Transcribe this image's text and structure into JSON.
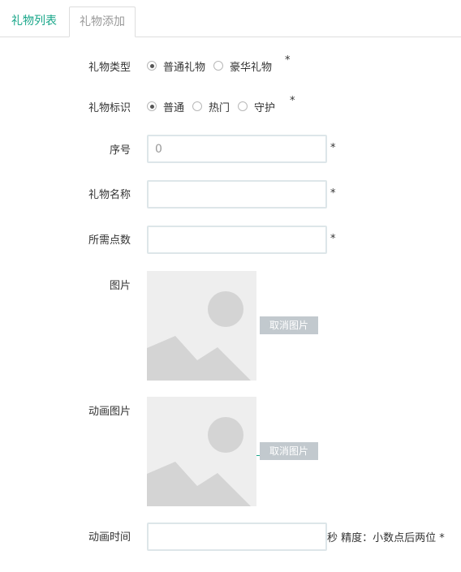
{
  "tabs": [
    {
      "label": "礼物列表",
      "active": false
    },
    {
      "label": "礼物添加",
      "active": true
    }
  ],
  "form": {
    "gift_type": {
      "label": "礼物类型",
      "options": [
        {
          "label": "普通礼物",
          "checked": true
        },
        {
          "label": "豪华礼物",
          "checked": false
        }
      ],
      "required_mark": "*"
    },
    "gift_mark": {
      "label": "礼物标识",
      "options": [
        {
          "label": "普通",
          "checked": true
        },
        {
          "label": "热门",
          "checked": false
        },
        {
          "label": "守护",
          "checked": false
        }
      ],
      "required_mark": "*"
    },
    "order": {
      "label": "序号",
      "placeholder": "0",
      "value": "",
      "required_mark": "*"
    },
    "name": {
      "label": "礼物名称",
      "value": "",
      "required_mark": "*"
    },
    "points": {
      "label": "所需点数",
      "value": "",
      "required_mark": "*"
    },
    "image": {
      "label": "图片",
      "cancel_label": "取消图片"
    },
    "anim_image": {
      "label": "动画图片",
      "cancel_label": "取消图片"
    },
    "anim_time": {
      "label": "动画时间",
      "value": "",
      "suffix": "秒 精度：小数点后两位 *"
    }
  },
  "colors": {
    "accent": "#18a689",
    "placeholder_bg": "#eeeeee",
    "placeholder_shape": "#d4d4d4",
    "cancel_button": "#c2c9ce",
    "input_border": "#dde6e9"
  },
  "icons": {
    "image_placeholder": "image-placeholder-icon"
  }
}
